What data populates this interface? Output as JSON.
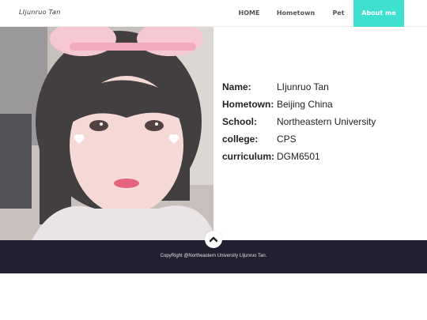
{
  "navbar": {
    "brand": "LIjunruo Tan",
    "items": [
      {
        "label": "HOME"
      },
      {
        "label": "Hometown"
      },
      {
        "label": "Pet"
      },
      {
        "label": "About me"
      }
    ],
    "active_color": "#40e0d0"
  },
  "photo": {
    "icon": "profile-photo"
  },
  "profile": {
    "rows": [
      {
        "label": "Name:",
        "value": "LIjunruo Tan"
      },
      {
        "label": "Hometown:",
        "value": "Beijing China"
      },
      {
        "label": "School:",
        "value": "Northeastern University"
      },
      {
        "label": "college:",
        "value": "CPS"
      },
      {
        "label": "curriculum:",
        "value": "DGM6501"
      }
    ]
  },
  "footer": {
    "copyright": "CopyRight @Northeastern University LIjunruo Tan.",
    "background": "#202030"
  },
  "scroll_top": {
    "icon": "chevron-up-icon"
  }
}
